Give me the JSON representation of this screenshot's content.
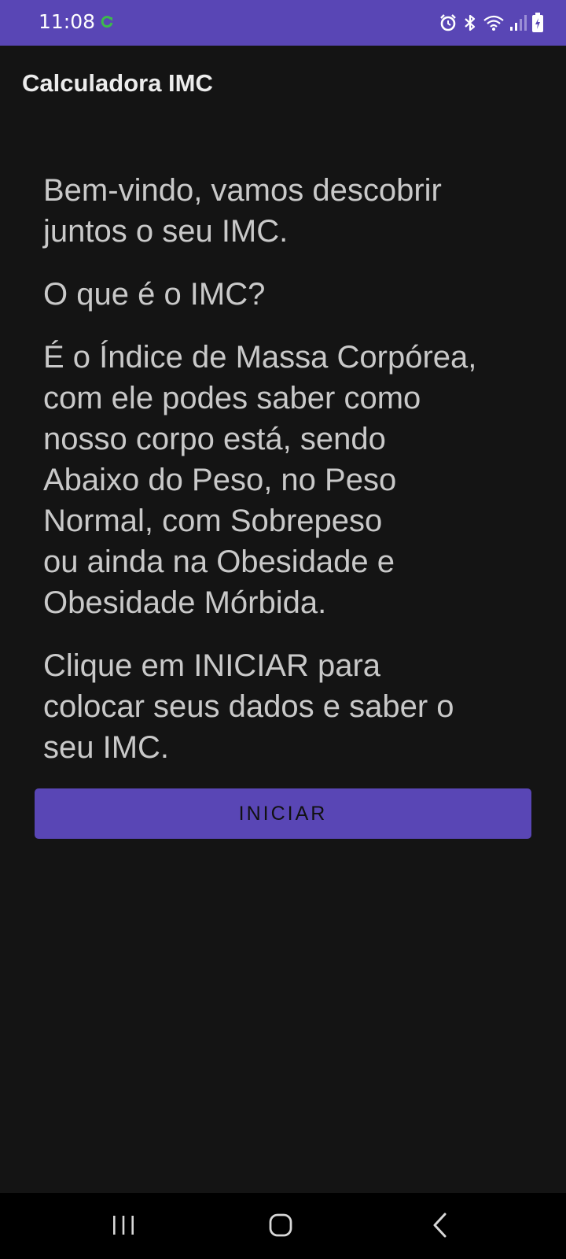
{
  "status_bar": {
    "time": "11:08",
    "icons": [
      "sync-icon",
      "alarm-icon",
      "bluetooth-icon",
      "wifi-icon",
      "signal-icon",
      "battery-charging-icon"
    ]
  },
  "app_bar": {
    "title": "Calculadora IMC"
  },
  "content": {
    "welcome": "Bem-vindo, vamos descobrir\njuntos o seu IMC.",
    "question": "O que é o IMC?",
    "explanation": "É o Índice de Massa Corpórea,\ncom ele podes saber como\nnosso corpo está, sendo\nAbaixo do Peso, no Peso\nNormal, com Sobrepeso\nou ainda na Obesidade e\nObesidade Mórbida.",
    "instruction": "Clique em INICIAR para\ncolocar seus dados e saber o\nseu IMC."
  },
  "start_button": {
    "label": "INICIAR"
  },
  "nav_bar": {
    "buttons": [
      "recents-icon",
      "home-icon",
      "back-icon"
    ]
  },
  "colors": {
    "accent": "#5946b5",
    "background": "#141414",
    "text": "#c9c9c9",
    "title": "#ececec",
    "sync_green": "#3dbb4b"
  }
}
